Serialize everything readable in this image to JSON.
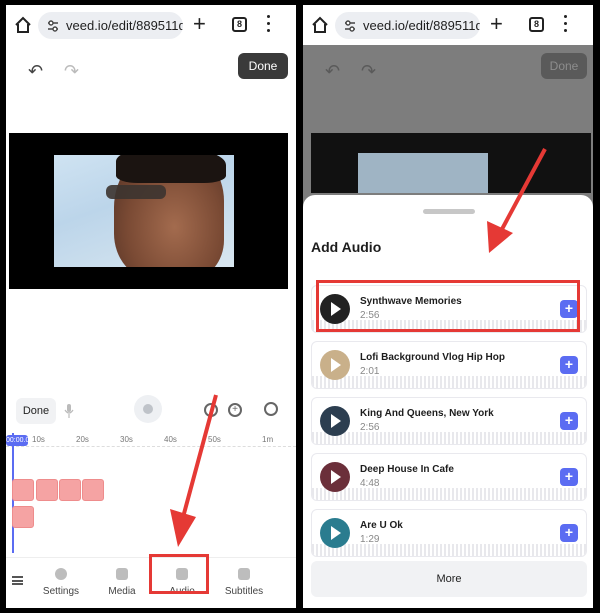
{
  "browser": {
    "url": "veed.io/edit/889511d",
    "url_right": "veed.io/edit/889511d…",
    "tab_count": "8"
  },
  "left": {
    "done_top_label": "Done",
    "done_timeline_label": "Done",
    "timeline_marks": [
      "00:00.0",
      "10s",
      "20s",
      "30s",
      "40s",
      "50s",
      "1m"
    ],
    "nav": {
      "settings": "Settings",
      "media": "Media",
      "audio": "Audio",
      "subtitles": "Subtitles"
    }
  },
  "right": {
    "done_top_label": "Done",
    "panel_title": "Add Audio",
    "tracks": [
      {
        "name": "Synthwave Memories",
        "duration": "2:56"
      },
      {
        "name": "Lofi Background Vlog Hip Hop",
        "duration": "2:01"
      },
      {
        "name": "King And Queens, New York",
        "duration": "2:56"
      },
      {
        "name": "Deep House In Cafe",
        "duration": "4:48"
      },
      {
        "name": "Are U Ok",
        "duration": "1:29"
      }
    ],
    "add_button_symbol": "+",
    "more_label": "More"
  },
  "colors": {
    "accent": "#5b6cf2",
    "highlight": "#e53935",
    "clip": "#f5a3a3"
  }
}
